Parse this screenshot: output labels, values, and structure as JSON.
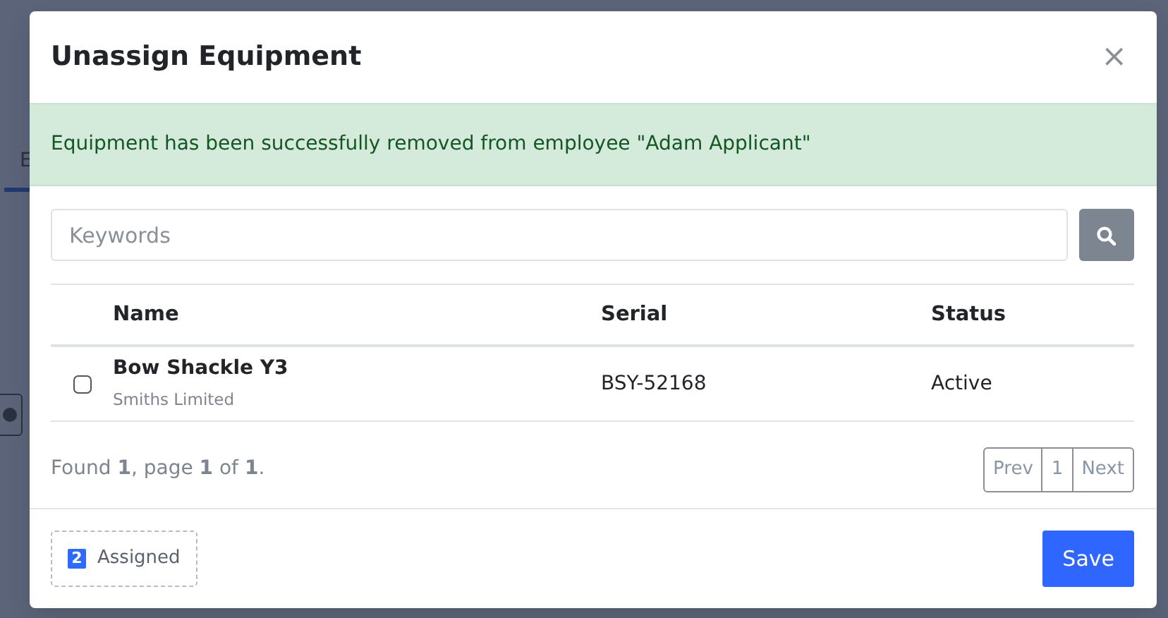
{
  "background_page": {
    "tab": "E"
  },
  "modal": {
    "title": "Unassign Equipment",
    "close": "×",
    "alert": {
      "text": "Equipment has been successfully removed from employee \"Adam Applicant\""
    },
    "search": {
      "placeholder": "Keywords"
    },
    "table": {
      "columns": [
        "Name",
        "Serial",
        "Status"
      ],
      "rows": [
        {
          "checked": false,
          "name": "Bow Shackle Y3",
          "supplier": "Smiths Limited",
          "serial": "BSY-52168",
          "status": "Active"
        }
      ]
    },
    "summary": "Found **1**, page **1** of **1**.",
    "pagination": [
      {
        "label": "Prev",
        "disabled": true
      },
      {
        "label": "1",
        "disabled": true
      },
      {
        "label": "Next",
        "disabled": true
      }
    ],
    "assigned": {
      "count": "2",
      "label": "Assigned"
    },
    "save": "Save"
  }
}
